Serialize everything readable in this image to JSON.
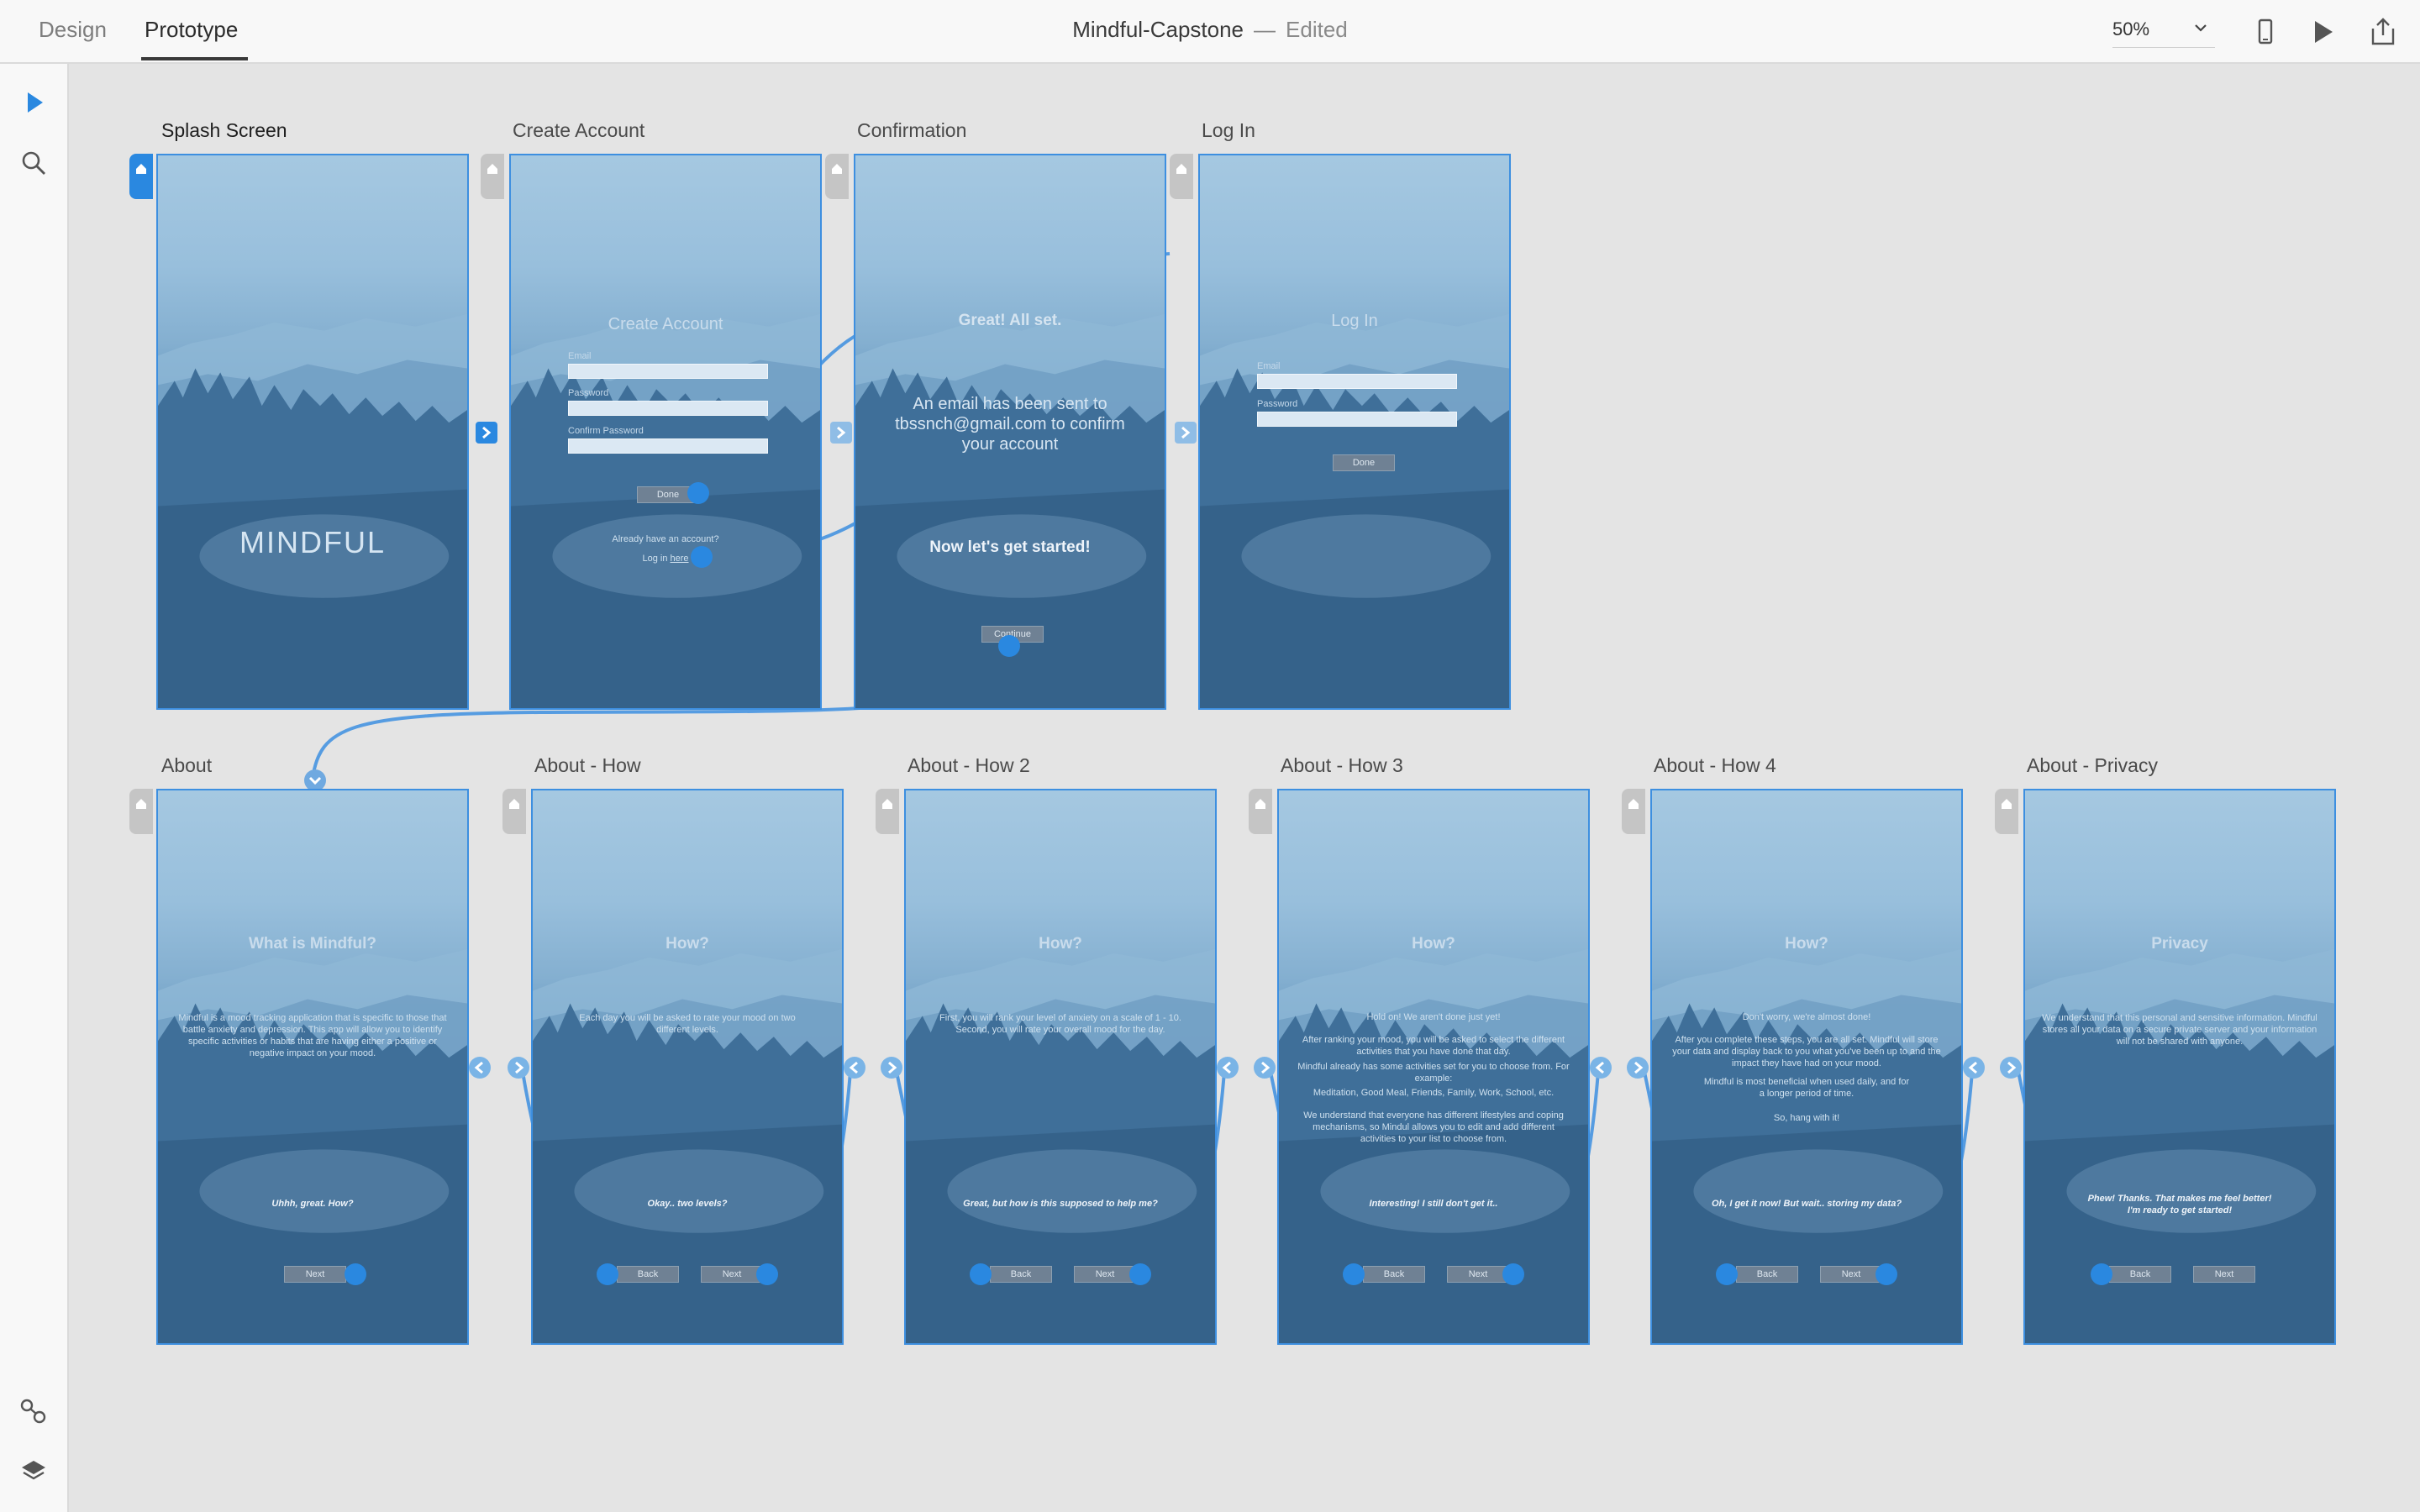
{
  "header": {
    "tabs": [
      {
        "label": "Design"
      },
      {
        "label": "Prototype"
      }
    ],
    "doc_name": "Mindful-Capstone",
    "separator": "—",
    "status": "Edited",
    "zoom": "50%"
  },
  "icons": {
    "device_preview": "phone-icon",
    "play": "play-icon",
    "share": "share-icon",
    "select_tool": "arrow-select-icon",
    "zoom_tool": "magnifier-icon",
    "components": "link-nodes-icon",
    "layers": "layers-icon"
  },
  "colors": {
    "accent": "#2a88e0",
    "artboard_border": "#3d8fe0",
    "canvas": "#e4e4e4"
  },
  "artboards": {
    "splash": {
      "name": "Splash Screen",
      "logo": "MINDFUL"
    },
    "create": {
      "name": "Create Account",
      "title": "Create Account",
      "email": "Email",
      "password": "Password",
      "confirm": "Confirm Password",
      "done": "Done",
      "have": "Already have an account?",
      "login_pre": "Log in ",
      "login_link": "here"
    },
    "confirm": {
      "name": "Confirmation",
      "title": "Great! All set.",
      "body": "An email has been sent to tbssnch@gmail.com to confirm your account",
      "cta": "Now let's get started!",
      "continue": "Continue"
    },
    "login": {
      "name": "Log In",
      "title": "Log In",
      "email": "Email",
      "password": "Password",
      "done": "Done"
    },
    "about": {
      "name": "About",
      "title": "What is Mindful?",
      "body": "Mindful is a mood tracking application that is specific to those that battle anxiety and depression. This app will allow you to identify specific activities or habits that are having either a positive or negative impact on your mood.",
      "reply": "Uhhh, great. How?",
      "next": "Next"
    },
    "how": {
      "name": "About - How",
      "title": "How?",
      "body": "Each day you will be asked to rate your mood on two different levels.",
      "reply": "Okay.. two levels?",
      "back": "Back",
      "next": "Next"
    },
    "how2": {
      "name": "About - How 2",
      "title": "How?",
      "body": "First, you will rank your level of anxiety on a scale of 1 - 10. Second, you will rate your overall mood for the day.",
      "reply": "Great, but how is this supposed to help me?",
      "back": "Back",
      "next": "Next"
    },
    "how3": {
      "name": "About - How 3",
      "title": "How?",
      "body1": "Hold on! We aren't done just yet!",
      "body2": "After ranking your mood, you will be asked to select the different activities that you have done that day.",
      "body3": "Mindful already has some activities set for you to choose from. For example:",
      "body4": "Meditation, Good Meal, Friends, Family, Work, School, etc.",
      "body5": "We understand that everyone has different lifestyles and coping mechanisms, so Mindul allows you to edit and add different activities to your list to choose from.",
      "reply": "Interesting! I still don't get it..",
      "back": "Back",
      "next": "Next"
    },
    "how4": {
      "name": "About - How 4",
      "title": "How?",
      "body1": "Don't worry, we're almost done!",
      "body2": "After you complete these steps, you are all set. Mindful will store your data and display back to you what you've been up to and the impact they have had on your mood.",
      "body3": "Mindful is most beneficial when used daily, and for a longer period of time.",
      "body4": "So, hang with it!",
      "reply": "Oh, I get it now! But wait.. storing my data?",
      "back": "Back",
      "next": "Next"
    },
    "privacy": {
      "name": "About - Privacy",
      "title": "Privacy",
      "body": "We understand that this personal and sensitive information. Mindful stores all your data on a secure private server and your information will not be shared with anyone.",
      "reply1": "Phew! Thanks. That makes me feel better!",
      "reply2": "I'm ready to get started!",
      "back": "Back",
      "next": "Next"
    }
  }
}
